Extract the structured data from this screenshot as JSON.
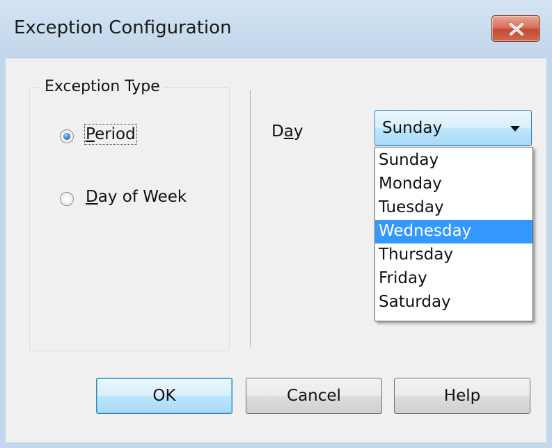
{
  "window": {
    "title": "Exception Configuration",
    "close_icon": "close-icon"
  },
  "exception_type": {
    "legend": "Exception Type",
    "options": [
      {
        "label_first": "P",
        "label_rest": "eriod",
        "checked": true
      },
      {
        "label_first": "D",
        "label_rest": "ay of Week",
        "checked": false
      }
    ]
  },
  "day": {
    "label_pre": "D",
    "label_ul": "a",
    "label_post": "y",
    "selected_value": "Sunday",
    "options": [
      "Sunday",
      "Monday",
      "Tuesday",
      "Wednesday",
      "Thursday",
      "Friday",
      "Saturday"
    ],
    "highlighted": "Wednesday"
  },
  "buttons": {
    "ok": "OK",
    "cancel": "Cancel",
    "help": "Help"
  },
  "colors": {
    "highlight": "#3399ff",
    "close_button": "#c44a32",
    "titlebar": "#c3d8ec"
  }
}
